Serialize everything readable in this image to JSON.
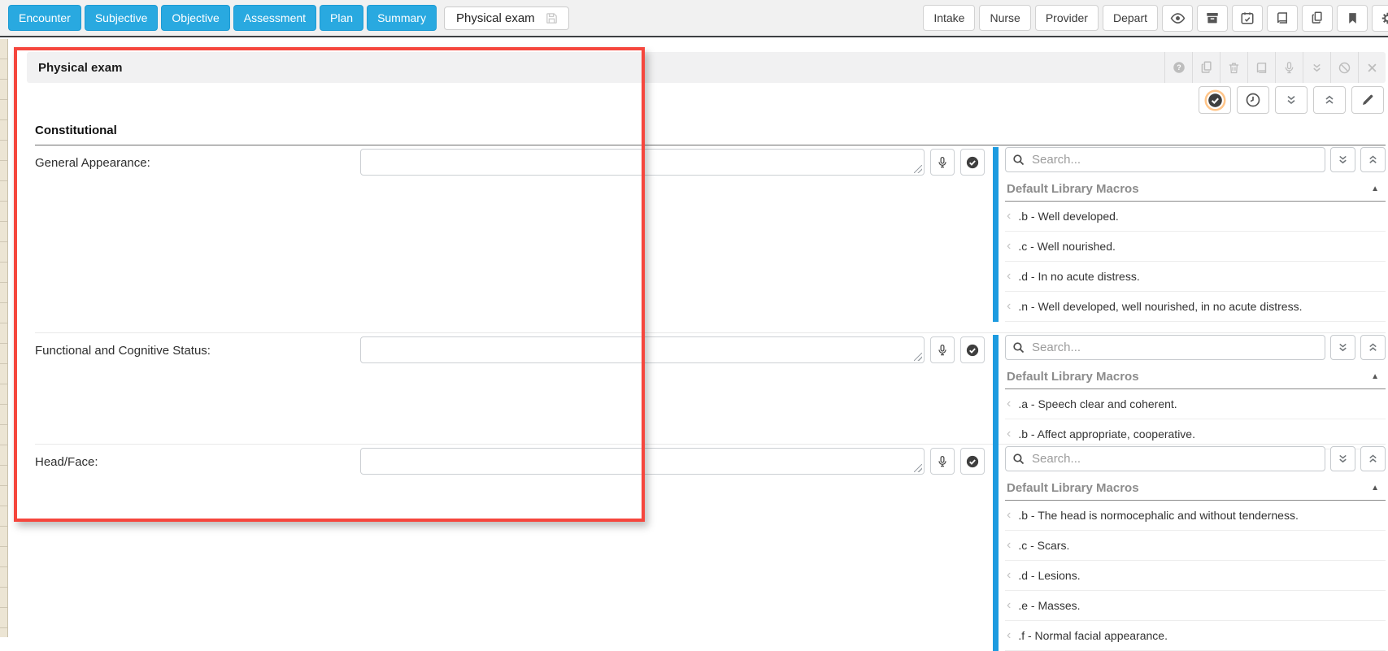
{
  "topbar": {
    "nav_buttons": [
      "Encounter",
      "Subjective",
      "Objective",
      "Assessment",
      "Plan",
      "Summary"
    ],
    "active_tab": {
      "label": "Physical exam",
      "save_icon": "floppy-save-icon"
    },
    "right_buttons": [
      "Intake",
      "Nurse",
      "Provider",
      "Depart"
    ],
    "right_icons": [
      "eye-icon",
      "archive-box-icon",
      "calendar-check-icon",
      "book-icon",
      "copy-icon",
      "bookmark-icon",
      "gear-icon"
    ]
  },
  "section": {
    "title": "Physical exam",
    "header_icons": [
      "help-circle-icon",
      "copy-icon",
      "trash-icon",
      "book-icon",
      "microphone-icon",
      "double-chevron-down-icon",
      "ban-icon",
      "close-icon"
    ],
    "toolbar_icons": [
      "check-circle-icon",
      "clock-icon",
      "double-chevron-down-icon",
      "double-chevron-up-icon",
      "pencil-icon"
    ]
  },
  "form": {
    "group_heading": "Constitutional",
    "rows": [
      {
        "label": "General Appearance:",
        "value": "",
        "search_placeholder": "Search...",
        "macros_title": "Default Library Macros",
        "macros": [
          ".b - Well developed.",
          ".c - Well nourished.",
          ".d - In no acute distress.",
          ".n - Well developed, well nourished, in no acute distress."
        ]
      },
      {
        "label": "Functional and Cognitive Status:",
        "value": "",
        "search_placeholder": "Search...",
        "macros_title": "Default Library Macros",
        "macros": [
          ".a - Speech clear and coherent.",
          ".b - Affect appropriate, cooperative."
        ]
      },
      {
        "label": "Head/Face:",
        "value": "",
        "search_placeholder": "Search...",
        "macros_title": "Default Library Macros",
        "macros": [
          ".b - The head is normocephalic and without tenderness.",
          ".c - Scars.",
          ".d - Lesions.",
          ".e - Masses.",
          ".f - Normal facial appearance."
        ]
      }
    ]
  },
  "colors": {
    "nav_blue": "#29a9e0",
    "macro_bar_blue": "#1d9be0",
    "annotation_red": "#f5463d"
  }
}
